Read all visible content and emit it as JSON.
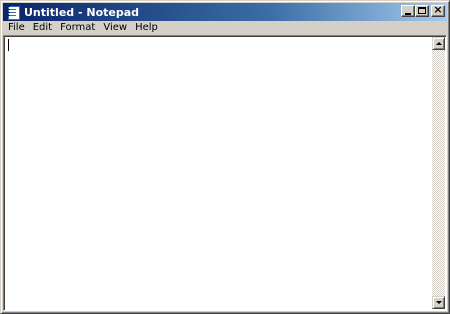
{
  "window": {
    "title": "Untitled - Notepad",
    "titlebar_colors": {
      "start": "#0a246a",
      "end": "#a6caf0"
    }
  },
  "title_buttons": {
    "minimize_icon": "minimize-icon",
    "maximize_icon": "maximize-icon",
    "close_icon": "close-icon",
    "close_glyph": "×"
  },
  "menubar": {
    "items": [
      {
        "label": "File"
      },
      {
        "label": "Edit"
      },
      {
        "label": "Format"
      },
      {
        "label": "View"
      },
      {
        "label": "Help"
      }
    ]
  },
  "editor": {
    "content": ""
  },
  "scrollbar": {
    "up_icon": "scroll-up-arrow-icon",
    "down_icon": "scroll-down-arrow-icon"
  }
}
